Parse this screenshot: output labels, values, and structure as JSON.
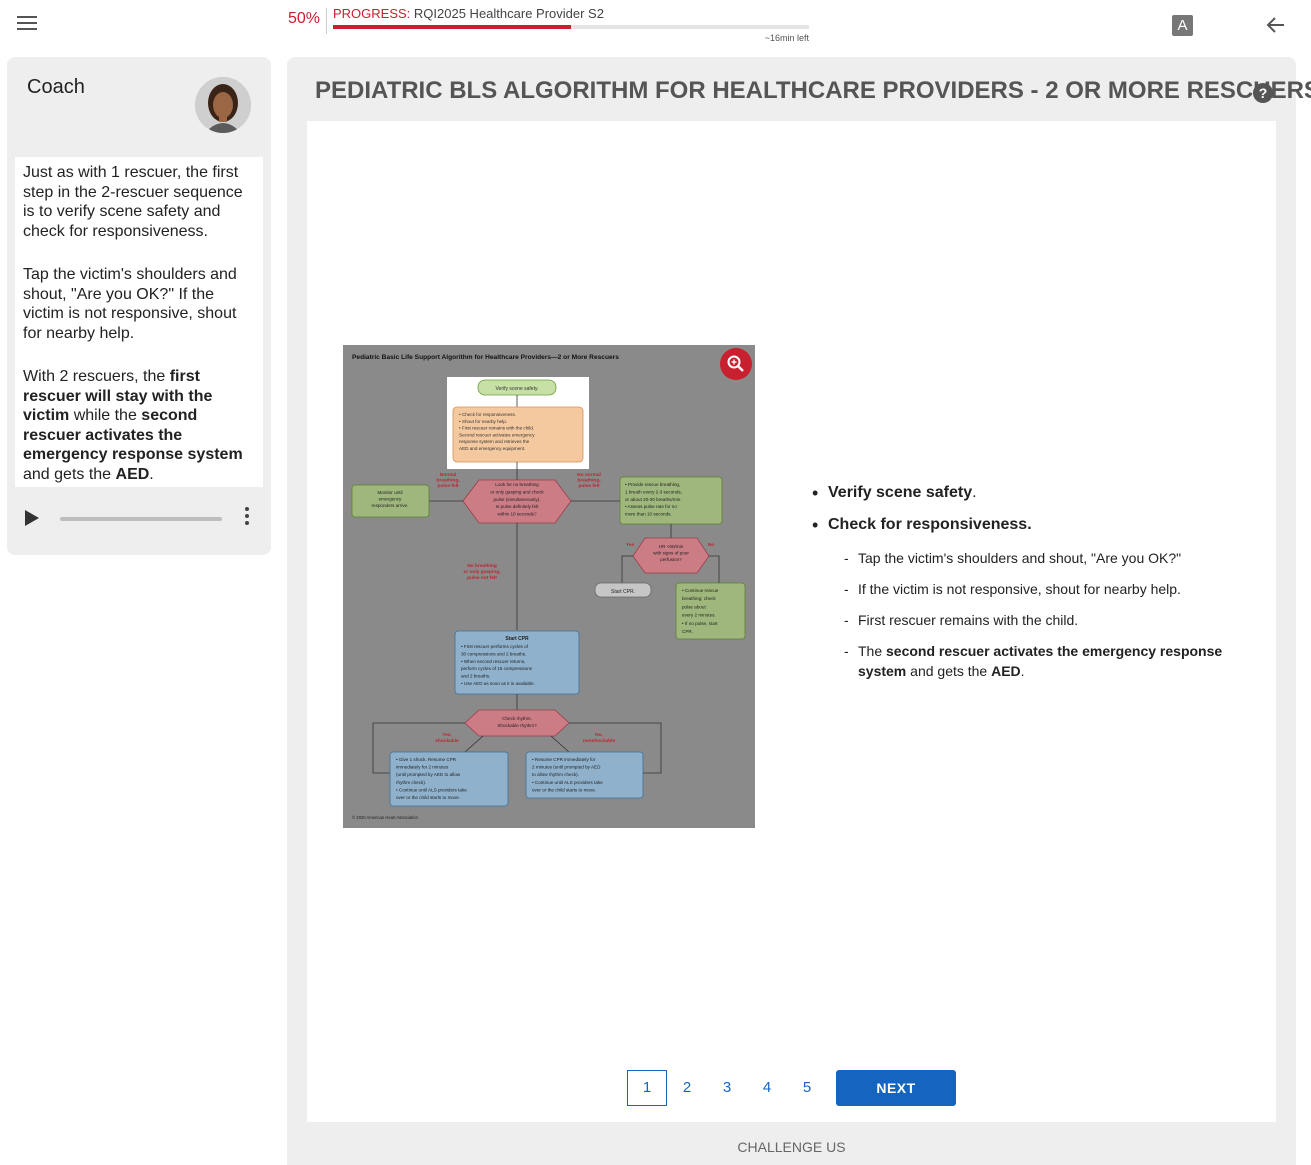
{
  "topbar": {
    "menu_icon": "hamburger-menu-icon",
    "progress_percent_text": "50%",
    "progress_fraction": 0.5,
    "progress_label_key": "PROGRESS:",
    "progress_label_value": " RQI2025 Healthcare Provider S2",
    "time_left": "~16min left",
    "font_button_label": "A",
    "back_icon": "arrow-left-icon",
    "accent_color": "#c8202f"
  },
  "coach": {
    "title": "Coach",
    "avatar_icon": "coach-avatar",
    "paragraphs": {
      "p1": "Just as with 1 rescuer, the first step in the 2-rescuer sequence is to verify scene safety and check for responsiveness.",
      "p2": "Tap the victim's shoulders and shout, \"Are you OK?\" If the victim is not responsive, shout for nearby help.",
      "p3_a": "With 2 rescuers, the ",
      "p3_b": "first rescuer will stay with the victim",
      "p3_c": " while the ",
      "p3_d": "second rescuer activates the emergency response system",
      "p3_e": " and gets the ",
      "p3_f": "AED",
      "p3_g": "."
    },
    "audio": {
      "play_icon": "play-icon",
      "more_icon": "more-vertical-icon"
    }
  },
  "main": {
    "title": "PEDIATRIC BLS ALGORITHM FOR HEALTHCARE PROVIDERS - 2 OR MORE RESCUERS",
    "help_label": "?",
    "algorithm": {
      "header": "Pediatric Basic Life Support Algorithm for Healthcare Providers—2 or More Rescuers",
      "verify": "Verify scene safety.",
      "check_lines": [
        "• Check for responsiveness.",
        "• Shout for nearby help.",
        "• First rescuer remains with the child.",
        "  Second rescuer activates emergency",
        "  response system and retrieves the",
        "  AED and emergency equipment."
      ],
      "normal_label": [
        "Normal",
        "breathing,",
        "pulse felt"
      ],
      "no_normal_label": [
        "No normal",
        "breathing,",
        "pulse felt"
      ],
      "monitor": [
        "Monitor until",
        "emergency",
        "responders arrive."
      ],
      "look": [
        "Look for no breathing",
        "or only gasping and check",
        "pulse (simultaneously).",
        "Is pulse definitely felt",
        "within 10 seconds?"
      ],
      "provide": [
        "• Provide rescue breathing,",
        "  1 breath every 2-3 seconds,",
        "  or about 20-30 breaths/min.",
        "• Assess pulse rate for no",
        "  more than 10 seconds."
      ],
      "yes": "Yes",
      "no": "No",
      "hr": [
        "HR <60/min",
        "with signs of poor",
        "perfusion?"
      ],
      "start_cpr_small": "Start CPR.",
      "continue": [
        "• Continue rescue",
        "  breathing; check",
        "  pulse about",
        "  every 2 minutes.",
        "• If no pulse, start",
        "  CPR."
      ],
      "no_breathing": [
        "No breathing",
        "or only gasping,",
        "pulse not felt"
      ],
      "start_cpr_title": "Start CPR",
      "start_cpr_lines": [
        "• First rescuer performs cycles of",
        "  30 compressions and 2 breaths.",
        "• When second rescuer returns,",
        "  perform cycles of 15 compressions",
        "  and 2 breaths.",
        "• Use AED as soon as it is available."
      ],
      "check_rhythm": [
        "Check rhythm.",
        "Shockable rhythm?"
      ],
      "yes_shockable": [
        "Yes,",
        "shockable"
      ],
      "no_nonshockable": [
        "No,",
        "nonshockable"
      ],
      "shock_box": [
        "• Give 1 shock. Resume CPR",
        "  immediately for 2 minutes",
        "  (until prompted by AED to allow",
        "  rhythm check).",
        "• Continue until ALS providers take",
        "  over or the child starts to move."
      ],
      "resume_box": [
        "• Resume CPR immediately for",
        "  2 minutes (until prompted by AED",
        "  to allow rhythm check).",
        "• Continue until ALS providers take",
        "  over or the child starts to move."
      ],
      "copyright": "© 2020 American Heart Association",
      "zoom_icon": "zoom-in-icon"
    },
    "bullets": {
      "b1_bold": "Verify scene safety",
      "b1_tail": ".",
      "b2_bold": "Check for responsiveness.",
      "s1": "Tap the victim's shoulders and shout, \"Are you OK?\"",
      "s2": "If the victim is not responsive, shout for nearby help.",
      "s3": "First rescuer remains with the child.",
      "s4_a": "The ",
      "s4_b": "second rescuer activates the emergency response system",
      "s4_c": " and gets the ",
      "s4_d": "AED",
      "s4_e": "."
    },
    "pager": {
      "pages": [
        "1",
        "2",
        "3",
        "4",
        "5"
      ],
      "active_page": "1",
      "next_label": "NEXT"
    },
    "challenge_label": "CHALLENGE US"
  }
}
